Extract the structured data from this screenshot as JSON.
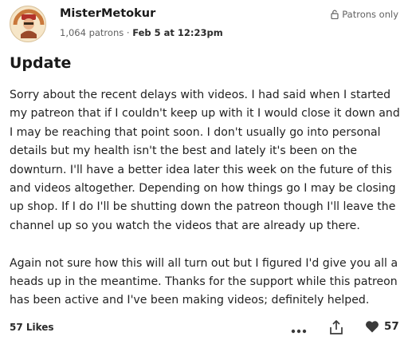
{
  "header": {
    "author": "MisterMetokur",
    "patron_count": "1,064 patrons",
    "separator": "·",
    "date": "Feb 5 at 12:23pm",
    "visibility": "Patrons only"
  },
  "post": {
    "title": "Update",
    "paragraphs": [
      "Sorry about the recent delays with videos.  I had said when I started my patreon that if I couldn't keep up with it I would close it down and I may be reaching that point soon.  I don't usually go into personal details but my health isn't the best and lately it's been on the downturn.  I'll have a better idea later this week on the future of this and videos altogether.  Depending on how things go I may be closing up shop.  If I do I'll be shutting down the patreon though I'll leave the channel up so you watch the videos that are already up there.",
      "Again not sure how this will all turn out but I figured I'd give you all a heads up in the meantime.  Thanks for the support while this patreon has been active and I've been making videos; definitely helped."
    ]
  },
  "footer": {
    "likes_label": "57 Likes",
    "like_count": "57"
  },
  "icons": {
    "lock": "lock-icon",
    "more": "more-icon",
    "share": "share-icon",
    "heart": "heart-icon"
  },
  "colors": {
    "text": "#1f1f1f",
    "muted": "#616161",
    "icon": "#3a3a3a"
  }
}
